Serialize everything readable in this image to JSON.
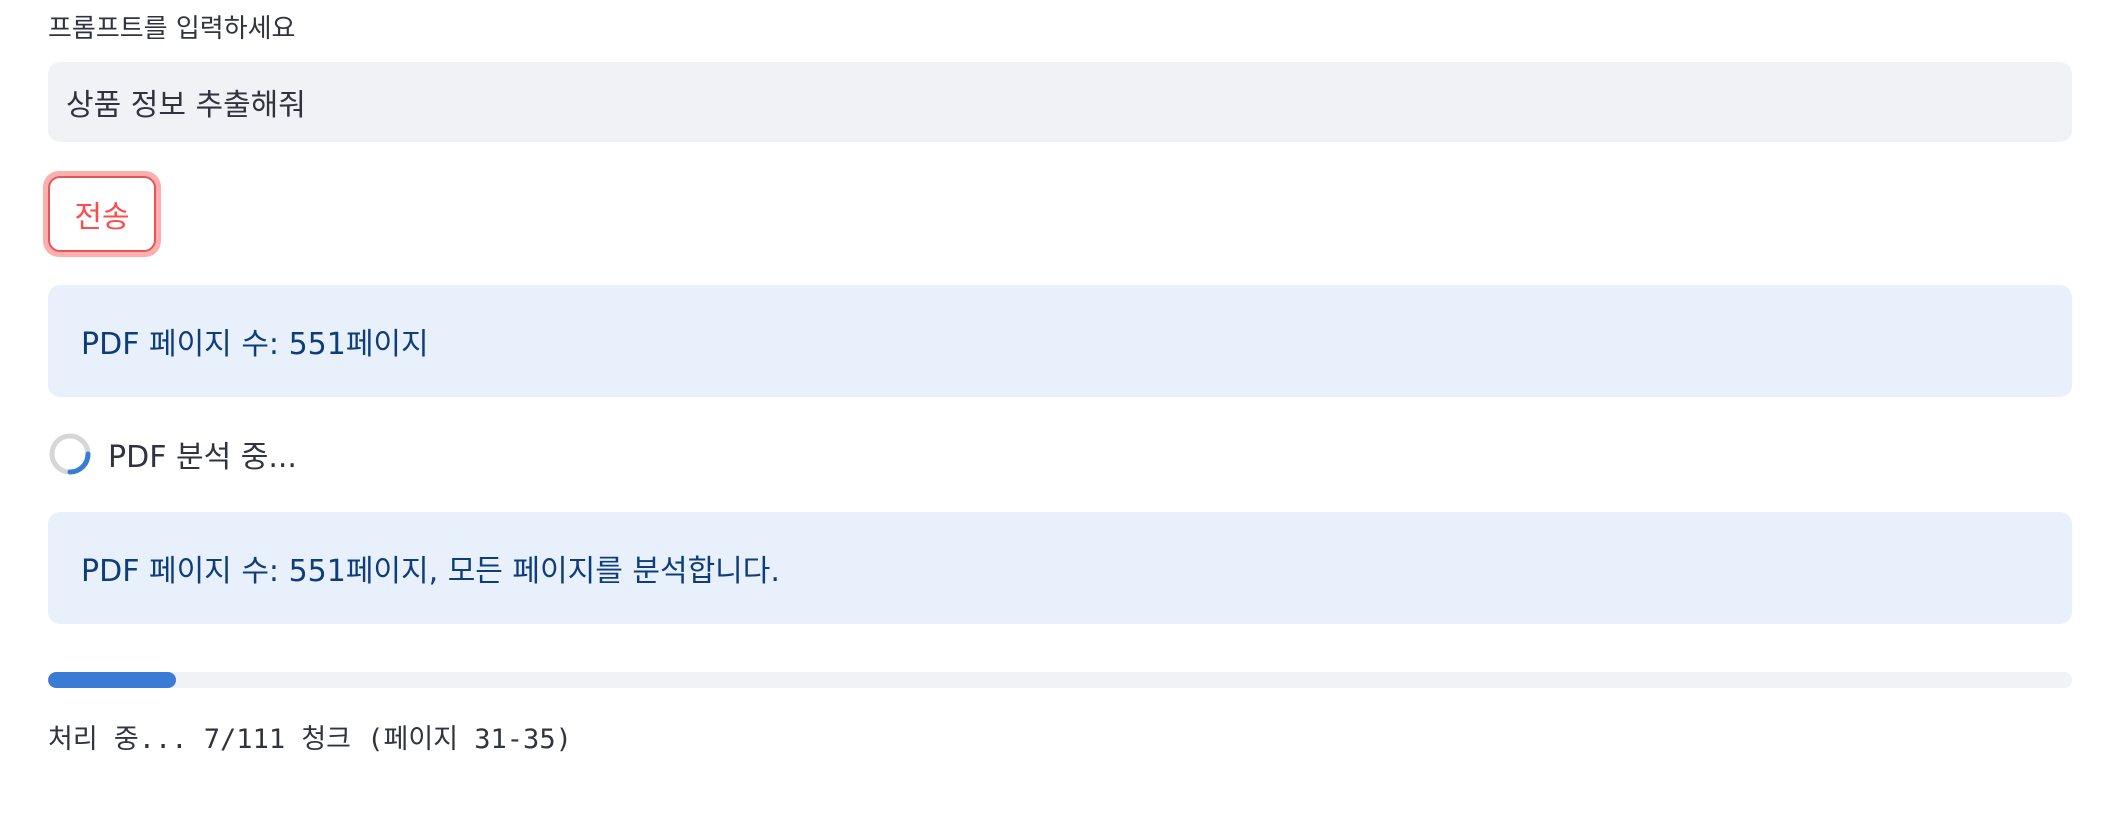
{
  "prompt": {
    "label": "프롬프트를 입력하세요",
    "value": "상품 정보 추출해줘"
  },
  "submit": {
    "label": "전송"
  },
  "info_page_count": "PDF 페이지 수: 551페이지",
  "spinner": {
    "text": "PDF 분석 중..."
  },
  "info_analyze_all": "PDF 페이지 수: 551페이지, 모든 페이지를 분석합니다.",
  "progress": {
    "fraction": 0.063,
    "text": "처리 중... 7/111 청크 (페이지 31-35)"
  },
  "colors": {
    "accent": "#ff4b4b",
    "info_bg": "#e8f0fb",
    "info_text": "#0f3d7a",
    "progress": "#3a7bd5",
    "input_bg": "#f0f2f6"
  },
  "icons": {
    "spinner": "loading-spinner-icon"
  }
}
